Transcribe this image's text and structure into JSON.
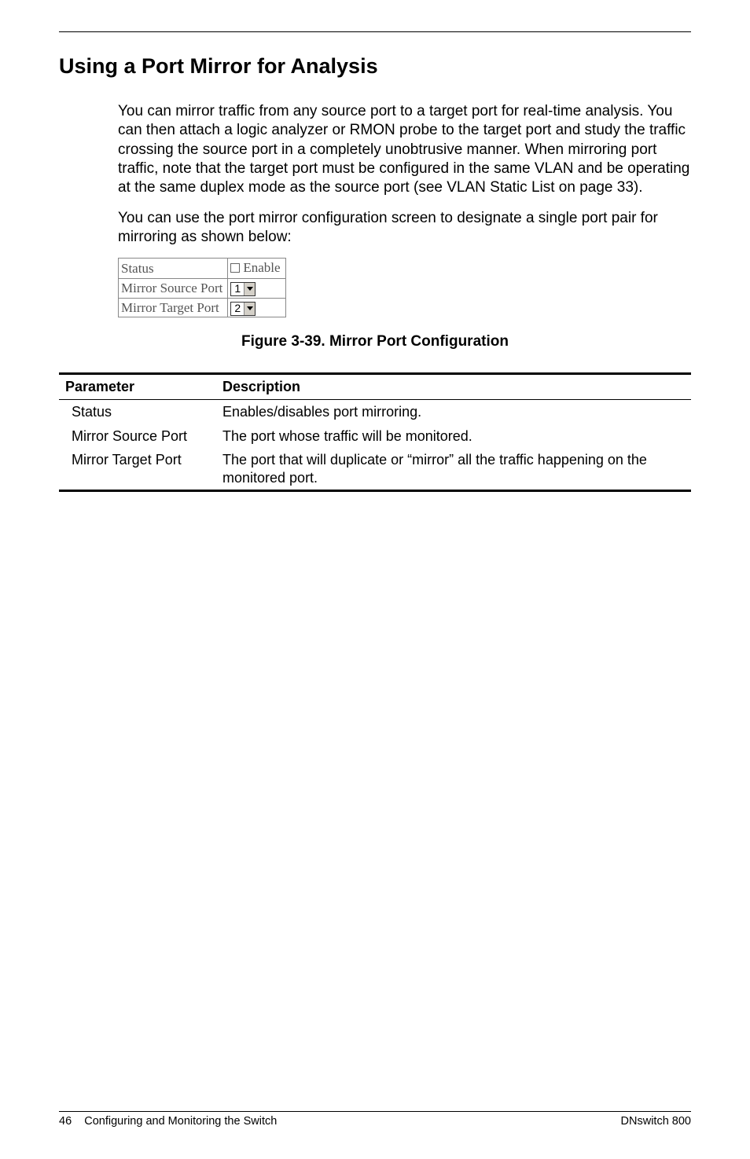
{
  "heading": "Using a Port Mirror for Analysis",
  "para1": "You can mirror traffic from any source port to a target port for real-time analysis. You can then attach a logic analyzer or RMON probe to the target port and study the traffic crossing the source port in a completely unobtrusive manner. When mirroring port traffic, note that the target port must be configured in the same VLAN and be operating at the same duplex mode as the source port (see VLAN Static List on page 33).",
  "para2": "You can use the port mirror configuration screen to designate a single port pair for mirroring as shown below:",
  "ui": {
    "status_label": "Status",
    "enable_label": "Enable",
    "source_label": "Mirror Source Port",
    "source_value": "1",
    "target_label": "Mirror Target Port",
    "target_value": "2"
  },
  "figure_caption": "Figure 3-39.  Mirror Port Configuration",
  "param_table": {
    "header_param": "Parameter",
    "header_desc": "Description",
    "rows": [
      {
        "param": "Status",
        "desc": "Enables/disables port mirroring."
      },
      {
        "param": "Mirror Source Port",
        "desc": "The port whose traffic will be monitored."
      },
      {
        "param": "Mirror Target Port",
        "desc": "The port that will duplicate or “mirror” all the traffic happening on the monitored port."
      }
    ]
  },
  "footer": {
    "left_page": "46",
    "left_title": "Configuring and Monitoring the Switch",
    "right": "DNswitch 800"
  }
}
